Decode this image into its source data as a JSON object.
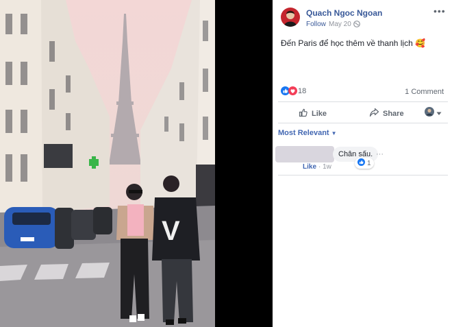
{
  "post": {
    "author": "Quach Ngoc Ngoan",
    "follow": "Follow",
    "separator": "·",
    "date": "May 20",
    "text": "Đến Paris để học thêm về thanh lịch",
    "emoji": "🥰"
  },
  "stats": {
    "reaction_count": "18",
    "comment_count": "1 Comment"
  },
  "actions": {
    "like": "Like",
    "share": "Share"
  },
  "comments": {
    "sort": "Most Relevant",
    "items": [
      {
        "text": "Chân sấu.",
        "like": "Like",
        "time": "1w",
        "reactions": "1"
      }
    ]
  },
  "colors": {
    "link": "#385898",
    "accent": "#4267b2",
    "like_blue": "#1877f2",
    "love_red": "#f33e58"
  },
  "icons": [
    "globe-icon",
    "more-icon",
    "like-reaction-icon",
    "love-reaction-icon",
    "thumb-up-icon",
    "share-arrow-icon",
    "caret-down-icon"
  ]
}
